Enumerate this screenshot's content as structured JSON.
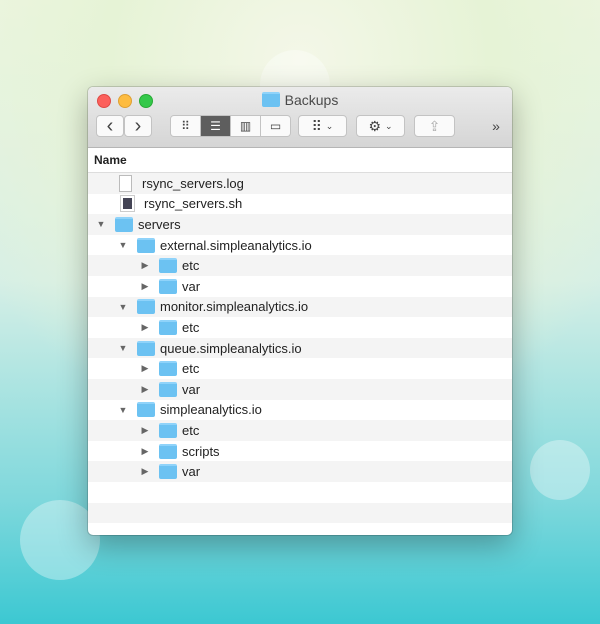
{
  "window": {
    "title": "Backups"
  },
  "toolbar": {
    "back": "‹",
    "forward": "›",
    "more": "»"
  },
  "header": {
    "name_col": "Name"
  },
  "rows": [
    {
      "label": "rsync_servers.log",
      "type": "file",
      "depth": 0,
      "expanded": null
    },
    {
      "label": "rsync_servers.sh",
      "type": "script",
      "depth": 0,
      "expanded": null
    },
    {
      "label": "servers",
      "type": "folder",
      "depth": 0,
      "expanded": true
    },
    {
      "label": "external.simpleanalytics.io",
      "type": "folder",
      "depth": 1,
      "expanded": true
    },
    {
      "label": "etc",
      "type": "folder",
      "depth": 2,
      "expanded": false
    },
    {
      "label": "var",
      "type": "folder",
      "depth": 2,
      "expanded": false
    },
    {
      "label": "monitor.simpleanalytics.io",
      "type": "folder",
      "depth": 1,
      "expanded": true
    },
    {
      "label": "etc",
      "type": "folder",
      "depth": 2,
      "expanded": false
    },
    {
      "label": "queue.simpleanalytics.io",
      "type": "folder",
      "depth": 1,
      "expanded": true
    },
    {
      "label": "etc",
      "type": "folder",
      "depth": 2,
      "expanded": false
    },
    {
      "label": "var",
      "type": "folder",
      "depth": 2,
      "expanded": false
    },
    {
      "label": "simpleanalytics.io",
      "type": "folder",
      "depth": 1,
      "expanded": true
    },
    {
      "label": "etc",
      "type": "folder",
      "depth": 2,
      "expanded": false
    },
    {
      "label": "scripts",
      "type": "folder",
      "depth": 2,
      "expanded": false
    },
    {
      "label": "var",
      "type": "folder",
      "depth": 2,
      "expanded": false
    }
  ]
}
